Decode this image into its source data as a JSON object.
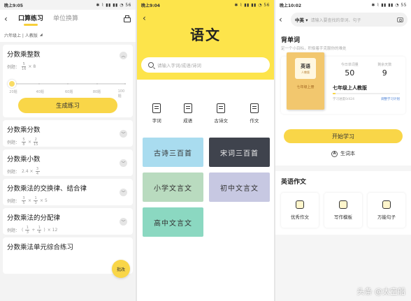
{
  "phone1": {
    "status": {
      "time": "晚上9:05",
      "icons": "✱ ⌇ ▮▮ ▮▮ ◔ 56"
    },
    "tabs": [
      "口算练习",
      "单位换算"
    ],
    "grade": "六年级上 | 人教版",
    "expanded": {
      "title": "分数乘整数",
      "example_prefix": "例题：",
      "example_num": "5",
      "example_den": "16",
      "example_tail": "× 8",
      "slider": {
        "labels": [
          "20题",
          "40题",
          "60题",
          "80题",
          "100题"
        ],
        "selected": "20题"
      },
      "button": "生成练习"
    },
    "items": [
      {
        "title": "分数乘分数",
        "prefix": "例题：",
        "num": "5",
        "den": "8",
        "op": "×",
        "num2": "2",
        "den2": "15",
        "tail": ""
      },
      {
        "title": "分数乘小数",
        "prefix": "例题：",
        "num": "",
        "den": "",
        "op": "2.4 ×",
        "num2": "3",
        "den2": "4",
        "tail": ""
      },
      {
        "title": "分数乘法的交换律、结合律",
        "prefix": "例题：",
        "num": "3",
        "den": "5",
        "op": "×",
        "num2": "1",
        "den2": "3",
        "tail": "× 5"
      },
      {
        "title": "分数乘法的分配律",
        "prefix": "例题：",
        "num": "1",
        "den": "3",
        "op": "+",
        "num2": "1",
        "den2": "4",
        "tail": "× 12"
      },
      {
        "title": "分数乘法单元综合练习"
      }
    ],
    "fab": "批改"
  },
  "phone2": {
    "status": {
      "time": "晚上9:04",
      "icons": "✱ ⌇ ▮▮ ▮▮ ◔ 56"
    },
    "title": "语文",
    "search_placeholder": "请输入字词/成语/诗词",
    "categories": [
      {
        "label": "字词",
        "icon": "word-book-icon"
      },
      {
        "label": "成语",
        "icon": "idiom-book-icon"
      },
      {
        "label": "古诗文",
        "icon": "poem-book-icon"
      },
      {
        "label": "作文",
        "icon": "essay-book-icon"
      }
    ],
    "tiles": [
      {
        "label": "古诗三百首",
        "color": "#a9dcef",
        "dark": false
      },
      {
        "label": "宋词三百首",
        "color": "#3f434d",
        "dark": true
      },
      {
        "label": "小学文言文",
        "color": "#b9dbbf",
        "dark": false
      },
      {
        "label": "初中文言文",
        "color": "#c7c8e2",
        "dark": false
      },
      {
        "label": "高中文言文",
        "color": "#8bd8c1",
        "dark": false
      }
    ]
  },
  "phone3": {
    "status": {
      "time": "晚上10:02",
      "icons": "✱ ⌇ ▮▮ ▮▮ ◔ 55"
    },
    "lang": "中英 ▾",
    "search_placeholder": "请输入要查找的单词、句子",
    "section_title": "背单词",
    "section_sub": "定一个小目标，积极着手克服你的难处",
    "book": {
      "badge": "英语",
      "publisher": "人教版",
      "name": "七年级上册"
    },
    "stats": [
      {
        "label": "今日单词量",
        "value": "50"
      },
      {
        "label": "剩余天数",
        "value": "9"
      }
    ],
    "book_title": "七年级上人教版",
    "progress": {
      "left": "学习进度0/424",
      "link": "调整学习计划"
    },
    "start_button": "开始学习",
    "vocab_icon": "A",
    "vocab_label": "生词本",
    "writing_title": "英语作文",
    "writing_cards": [
      "优秀作文",
      "写作模板",
      "万能句子"
    ]
  },
  "watermark": "头条 @太空船"
}
